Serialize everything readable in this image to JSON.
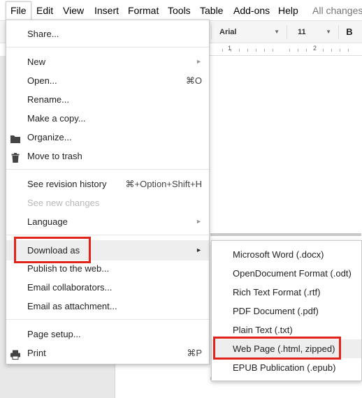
{
  "menubar": {
    "items": [
      "File",
      "Edit",
      "View",
      "Insert",
      "Format",
      "Tools",
      "Table",
      "Add-ons",
      "Help"
    ],
    "status": "All changes"
  },
  "toolbar": {
    "font": "Arial",
    "size": "11",
    "bold": "B"
  },
  "ruler": {
    "numbers": [
      "1",
      "2"
    ]
  },
  "file_menu": {
    "share": "Share...",
    "new": "New",
    "open": "Open...",
    "open_shortcut": "⌘O",
    "rename": "Rename...",
    "make_copy": "Make a copy...",
    "organize": "Organize...",
    "move_to_trash": "Move to trash",
    "see_revision_history": "See revision history",
    "revision_shortcut": "⌘+Option+Shift+H",
    "see_new_changes": "See new changes",
    "language": "Language",
    "download_as": "Download as",
    "publish": "Publish to the web...",
    "email_collaborators": "Email collaborators...",
    "email_attachment": "Email as attachment...",
    "page_setup": "Page setup...",
    "print": "Print",
    "print_shortcut": "⌘P",
    "arrow": "►"
  },
  "download_submenu": {
    "items": [
      "Microsoft Word (.docx)",
      "OpenDocument Format (.odt)",
      "Rich Text Format (.rtf)",
      "PDF Document (.pdf)",
      "Plain Text (.txt)",
      "Web Page (.html, zipped)",
      "EPUB Publication (.epub)"
    ]
  },
  "colors": {
    "highlight_box": "#e0241c",
    "hover_bg": "#eeeeee"
  }
}
